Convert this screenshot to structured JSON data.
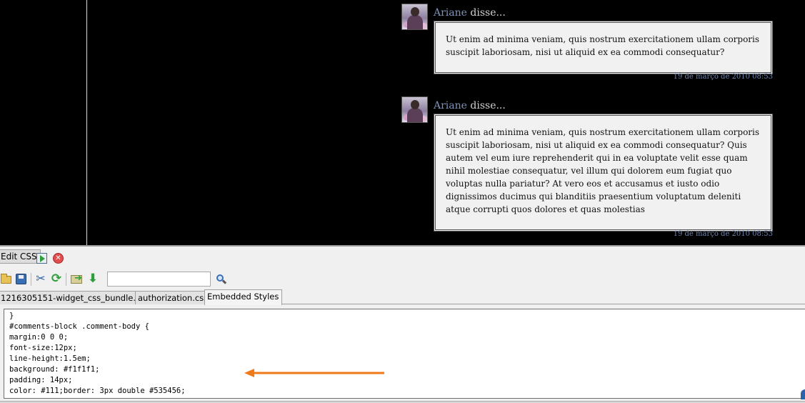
{
  "comments": [
    {
      "author": "Ariane",
      "said": " disse...",
      "body": "Ut enim ad minima veniam, quis nostrum exercitationem ullam corporis suscipit laboriosam, nisi ut aliquid ex ea commodi consequatur?",
      "date": "19 de março de 2010 08:53"
    },
    {
      "author": "Ariane",
      "said": " disse...",
      "body": "Ut enim ad minima veniam, quis nostrum exercitationem ullam corporis suscipit laboriosam, nisi ut aliquid ex ea commodi consequatur? Quis autem vel eum iure reprehenderit qui in ea voluptate velit esse quam nihil molestiae consequatur, vel illum qui dolorem eum fugiat quo voluptas nulla pariatur? At vero eos et accusamus et iusto odio dignissimos ducimus qui blanditiis praesentium voluptatum deleniti atque corrupti quos dolores et quas molestias",
      "date": "19 de março de 2010 08:53"
    }
  ],
  "panel": {
    "title": "Edit CSS",
    "close_glyph": "✕",
    "search": {
      "value": "",
      "placeholder": ""
    },
    "toolbar_icons": [
      "open-icon",
      "save-icon",
      "cut-icon",
      "reload-icon",
      "import-icon",
      "down-arrow-icon",
      "search-icon"
    ],
    "glyphs": {
      "cut": "✂",
      "reload": "⟳",
      "import_arrow": "➜",
      "down": "⬇"
    },
    "tabs": [
      {
        "label": "1216305151-widget_css_bundle.css",
        "active": false
      },
      {
        "label": "authorization.css",
        "active": false
      },
      {
        "label": "Embedded Styles",
        "active": true
      }
    ],
    "code_lines": [
      "}",
      "#comments-block .comment-body {",
      "margin:0 0 0;",
      "font-size:12px;",
      "line-height:1.5em;",
      "background: #f1f1f1;",
      "padding: 14px;",
      "color: #111;border: 3px double #535456;"
    ]
  },
  "colors": {
    "page_bg": "#000000",
    "comment_bg": "#f1f1f1",
    "comment_border": "#535456",
    "author_link": "#7f93b8",
    "date_text": "#6f84ad",
    "annotation_arrow": "#f07a1a"
  }
}
